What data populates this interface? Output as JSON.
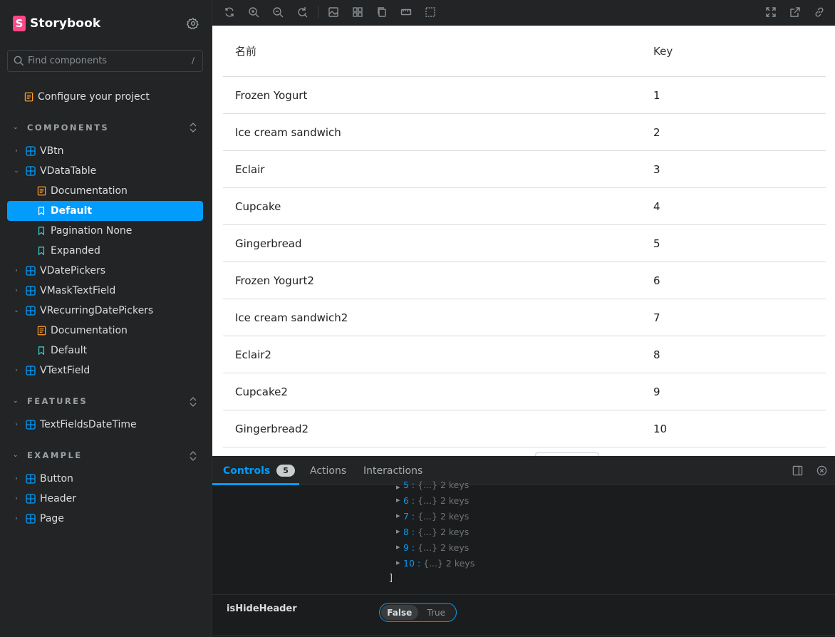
{
  "brand": {
    "name": "Storybook",
    "logo_letter": "S",
    "logo_color": "#ff4785"
  },
  "search": {
    "placeholder": "Find components",
    "shortcut": "/"
  },
  "sidebar": {
    "configure": "Configure your project",
    "sections": {
      "components": "COMPONENTS",
      "features": "FEATURES",
      "example": "EXAMPLE"
    },
    "items": {
      "vbtn": "VBtn",
      "vdatatable": "VDataTable",
      "dt_documentation": "Documentation",
      "dt_default": "Default",
      "dt_pagination_none": "Pagination None",
      "dt_expanded": "Expanded",
      "vdatepickers": "VDatePickers",
      "vmasktextfield": "VMaskTextField",
      "vrecurringdatepickers": "VRecurringDatePickers",
      "rdp_documentation": "Documentation",
      "rdp_default": "Default",
      "vtextfield": "VTextField",
      "textfieldsdatetime": "TextFieldsDateTime",
      "button": "Button",
      "header": "Header",
      "page": "Page"
    }
  },
  "table": {
    "headers": {
      "name": "名前",
      "key": "Key"
    },
    "rows": [
      {
        "name": "Frozen Yogurt",
        "key": "1"
      },
      {
        "name": "Ice cream sandwich",
        "key": "2"
      },
      {
        "name": "Eclair",
        "key": "3"
      },
      {
        "name": "Cupcake",
        "key": "4"
      },
      {
        "name": "Gingerbread",
        "key": "5"
      },
      {
        "name": "Frozen Yogurt2",
        "key": "6"
      },
      {
        "name": "Ice cream sandwich2",
        "key": "7"
      },
      {
        "name": "Eclair2",
        "key": "8"
      },
      {
        "name": "Cupcake2",
        "key": "9"
      },
      {
        "name": "Gingerbread2",
        "key": "10"
      }
    ]
  },
  "panel": {
    "tabs": {
      "controls": "Controls",
      "controls_count": "5",
      "actions": "Actions",
      "interactions": "Interactions"
    },
    "json_lines": [
      {
        "key": "5 :",
        "value": "{...} 2 keys"
      },
      {
        "key": "6 :",
        "value": "{...} 2 keys"
      },
      {
        "key": "7 :",
        "value": "{...} 2 keys"
      },
      {
        "key": "8 :",
        "value": "{...} 2 keys"
      },
      {
        "key": "9 :",
        "value": "{...} 2 keys"
      },
      {
        "key": "10 :",
        "value": "{...} 2 keys"
      }
    ],
    "close_bracket": "]",
    "control": {
      "label": "isHideHeader",
      "false_label": "False",
      "true_label": "True",
      "selected": "False"
    }
  },
  "colors": {
    "accent": "#029cfd",
    "sidebar_bg": "#222425",
    "preview_bg": "#ffffff"
  }
}
